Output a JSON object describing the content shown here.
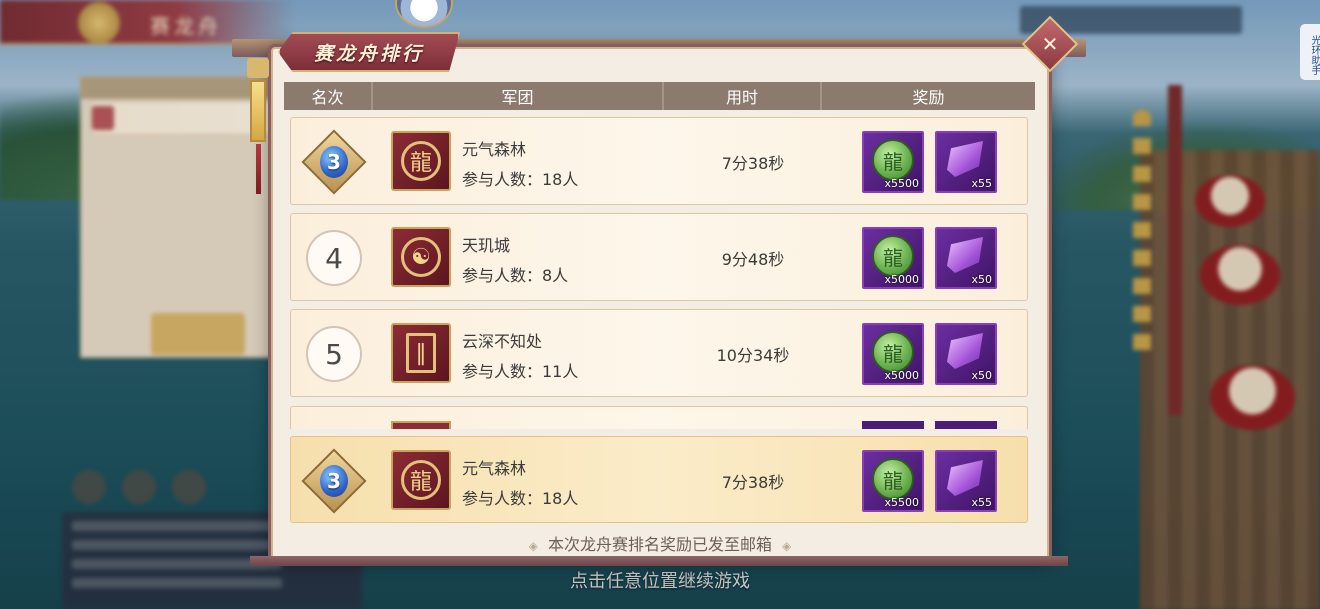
{
  "background": {
    "title": "赛龙舟",
    "bottom_hint": "点击任意位置继续游戏",
    "side_tab": "光环助手"
  },
  "modal": {
    "title": "赛龙舟排行",
    "close_icon": "close-x-icon",
    "headers": [
      "名次",
      "军团",
      "用时",
      "奖励"
    ],
    "rows": [
      {
        "rank": "3",
        "rank_style": "badge",
        "emblem": "dragon-emblem-icon",
        "name": "元气森林",
        "members": "参与人数：18人",
        "time": "7分38秒",
        "rewards": [
          {
            "icon": "jade-dragon-coin-icon",
            "qty": "x5500"
          },
          {
            "icon": "purple-scroll-icon",
            "qty": "x55"
          }
        ]
      },
      {
        "rank": "4",
        "rank_style": "plain",
        "emblem": "yin-yang-emblem-icon",
        "name": "天玑城",
        "members": "参与人数：8人",
        "time": "9分48秒",
        "rewards": [
          {
            "icon": "jade-dragon-coin-icon",
            "qty": "x5000"
          },
          {
            "icon": "purple-scroll-icon",
            "qty": "x50"
          }
        ]
      },
      {
        "rank": "5",
        "rank_style": "plain",
        "emblem": "gate-emblem-icon",
        "name": "云深不知处",
        "members": "参与人数：11人",
        "time": "10分34秒",
        "rewards": [
          {
            "icon": "jade-dragon-coin-icon",
            "qty": "x5000"
          },
          {
            "icon": "purple-scroll-icon",
            "qty": "x50"
          }
        ]
      }
    ],
    "my_row": {
      "rank": "3",
      "name": "元气森林",
      "members": "参与人数：18人",
      "time": "7分38秒",
      "rewards": [
        {
          "icon": "jade-dragon-coin-icon",
          "qty": "x5500"
        },
        {
          "icon": "purple-scroll-icon",
          "qty": "x55"
        }
      ]
    },
    "notice": "本次龙舟赛排名奖励已发至邮箱"
  },
  "colors": {
    "accent": "#8b5d60",
    "reward_frame": "#8a3fb6",
    "header_bg": "#8b7a6d"
  }
}
